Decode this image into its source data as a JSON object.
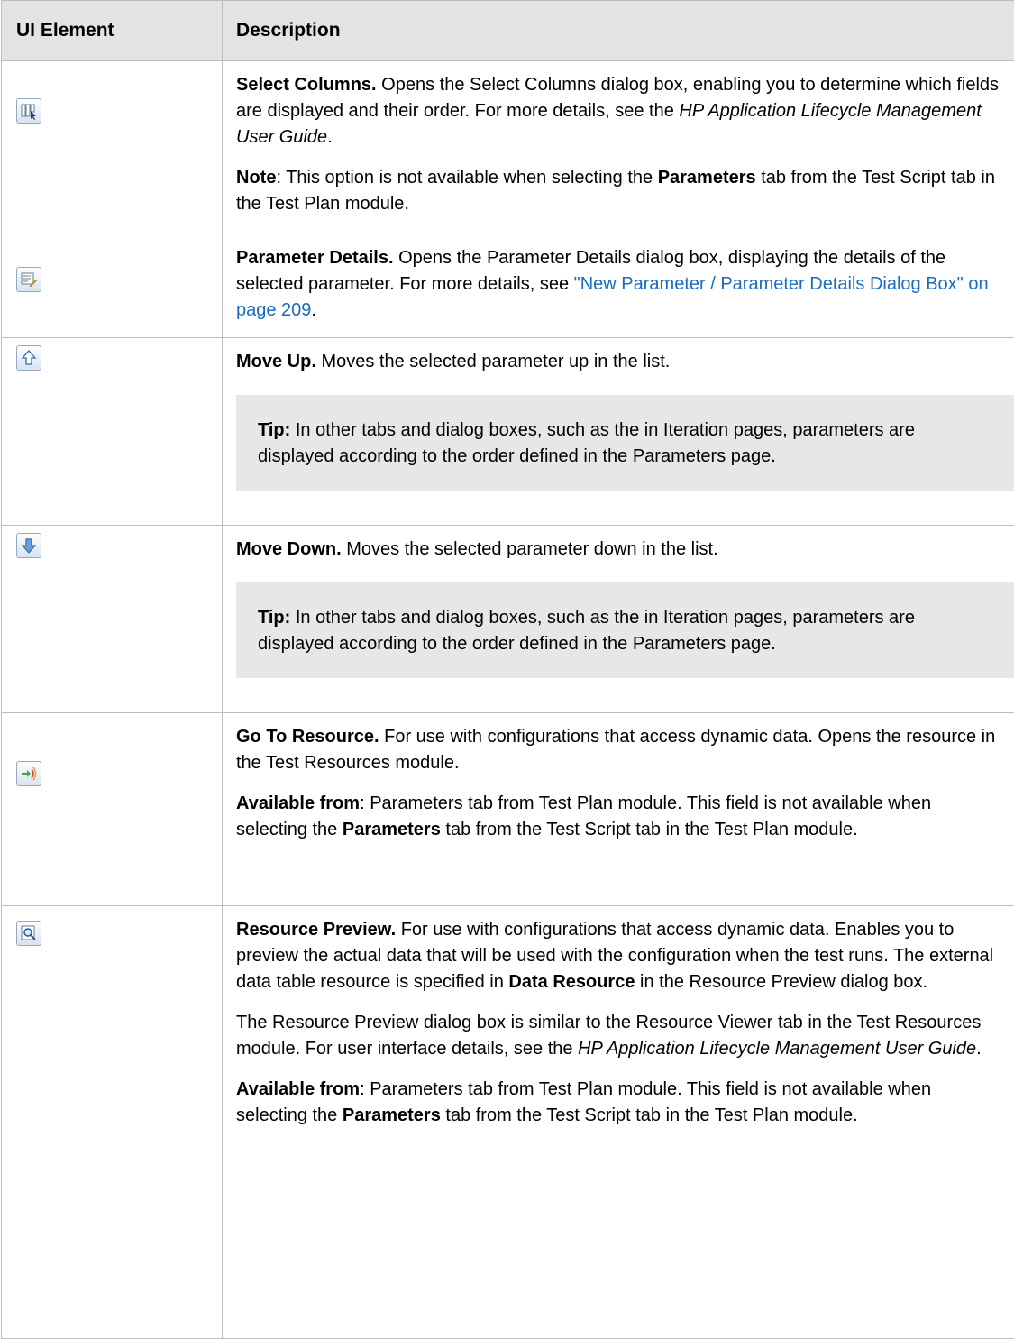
{
  "header": {
    "col1": "UI Element",
    "col2": "Description"
  },
  "rows": [
    {
      "icon": "select-columns-icon",
      "title": "Select Columns.",
      "text": " Opens the Select Columns dialog box, enabling you to determine which fields are displayed and their order. For more details, see the ",
      "guide": "HP Application Lifecycle Management User Guide",
      "end": ".",
      "note_label": "Note",
      "note_text1": ": This option is not available when selecting the ",
      "note_bold": "Parameters",
      "note_text2": " tab from the Test Script tab in the Test Plan module."
    },
    {
      "icon": "parameter-details-icon",
      "title": "Parameter Details.",
      "text": " Opens the Parameter Details dialog box, displaying the details of the selected parameter. For more details, see ",
      "link": "\"New Parameter / Parameter Details Dialog Box\" on page 209",
      "end": "."
    },
    {
      "icon": "move-up-icon",
      "title": "Move Up.",
      "text": " Moves the selected parameter up in the list.",
      "tip_label": "Tip:",
      "tip_text": " In other tabs and dialog boxes, such as the in Iteration pages, parameters are displayed according to the order defined in the Parameters page."
    },
    {
      "icon": "move-down-icon",
      "title": "Move Down.",
      "text": " Moves the selected parameter down in the list.",
      "tip_label": "Tip:",
      "tip_text": " In other tabs and dialog boxes, such as the in Iteration pages, parameters are displayed according to the order defined in the Parameters page."
    },
    {
      "icon": "go-to-resource-icon",
      "title": "Go To Resource.",
      "text": " For use with configurations that access dynamic data. Opens the resource in the Test Resources module.",
      "avail_label": "Available from",
      "avail_text1": ": Parameters tab from Test Plan module. This field is not available when selecting the ",
      "avail_bold": "Parameters",
      "avail_text2": " tab from the Test Script tab in the Test Plan module."
    },
    {
      "icon": "resource-preview-icon",
      "title": "Resource Preview.",
      "text": " For use with configurations that access dynamic data. Enables you to preview the actual data that will be used with the configuration when the test runs. The external data table resource is specified in ",
      "bold2": "Data Resource",
      "text2": " in the Resource Preview dialog box.",
      "para2_text": "The Resource Preview dialog box is similar to the Resource Viewer tab in the Test Resources module. For user interface details, see the ",
      "para2_guide": "HP Application Lifecycle Management User Guide",
      "para2_end": ".",
      "avail_label": "Available from",
      "avail_text1": ": Parameters tab from Test Plan module. This field is not available when selecting the ",
      "avail_bold": "Parameters",
      "avail_text2": " tab from the Test Script tab in the Test Plan module."
    }
  ]
}
